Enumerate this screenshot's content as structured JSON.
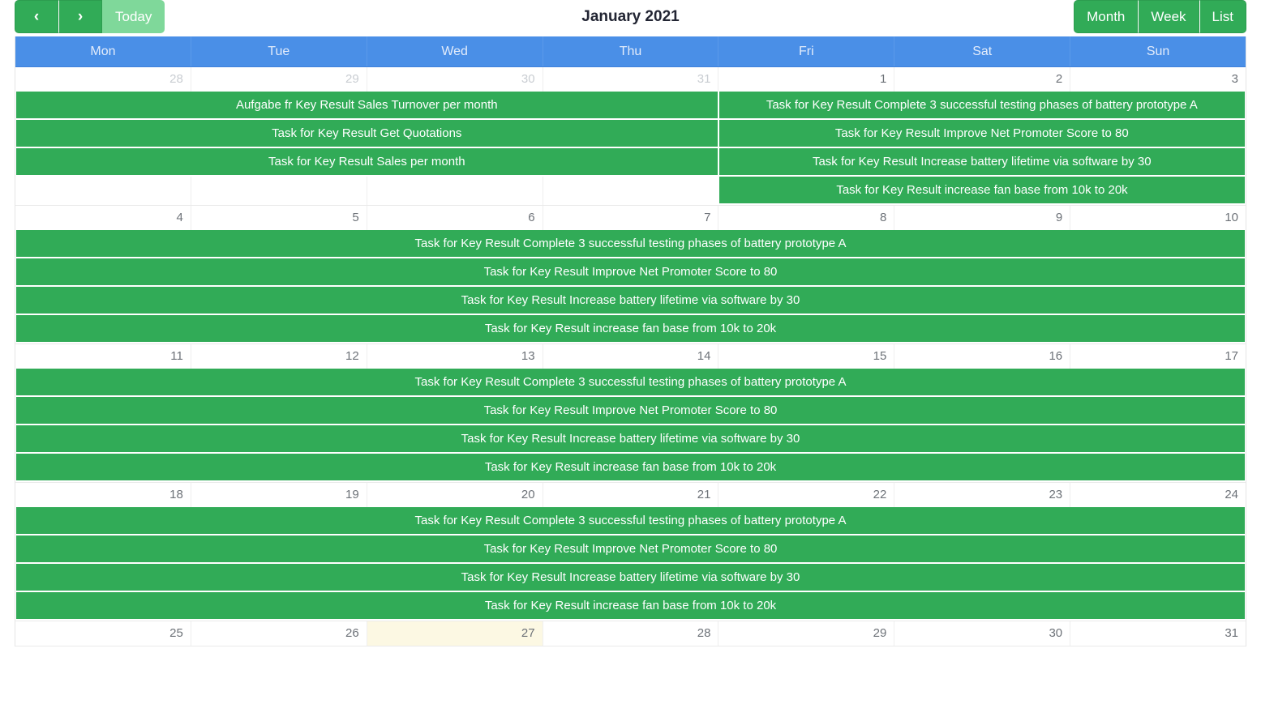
{
  "toolbar": {
    "prev_label": "‹",
    "next_label": "›",
    "today_label": "Today",
    "month_label": "Month",
    "week_label": "Week",
    "list_label": "List"
  },
  "title": "January 2021",
  "colors": {
    "event_green": "#31ab57",
    "header_blue": "#4a8fe7",
    "today_highlight": "#fcf8e3",
    "button_green": "#31ab57",
    "today_button_green": "#7fd89a"
  },
  "day_headers": [
    "Mon",
    "Tue",
    "Wed",
    "Thu",
    "Fri",
    "Sat",
    "Sun"
  ],
  "weeks": [
    {
      "days": [
        {
          "num": "28",
          "other_month": true,
          "today": false
        },
        {
          "num": "29",
          "other_month": true,
          "today": false
        },
        {
          "num": "30",
          "other_month": true,
          "today": false
        },
        {
          "num": "31",
          "other_month": true,
          "today": false
        },
        {
          "num": "1",
          "other_month": false,
          "today": false
        },
        {
          "num": "2",
          "other_month": false,
          "today": false
        },
        {
          "num": "3",
          "other_month": false,
          "today": false
        }
      ],
      "event_lines": [
        [
          {
            "type": "event",
            "span": 4,
            "text": "Aufgabe fr Key Result Sales Turnover per month"
          },
          {
            "type": "event",
            "span": 3,
            "text": "Task for Key Result Complete 3 successful testing phases of battery prototype A"
          }
        ],
        [
          {
            "type": "event",
            "span": 4,
            "text": "Task for Key Result Get Quotations"
          },
          {
            "type": "event",
            "span": 3,
            "text": "Task for Key Result Improve Net Promoter Score to 80"
          }
        ],
        [
          {
            "type": "event",
            "span": 4,
            "text": "Task for Key Result Sales per month"
          },
          {
            "type": "event",
            "span": 3,
            "text": "Task for Key Result Increase battery lifetime via software by 30"
          }
        ],
        [
          {
            "type": "filler",
            "span": 1,
            "text": ""
          },
          {
            "type": "filler",
            "span": 1,
            "text": ""
          },
          {
            "type": "filler",
            "span": 1,
            "text": ""
          },
          {
            "type": "filler",
            "span": 1,
            "text": ""
          },
          {
            "type": "event",
            "span": 3,
            "text": "Task for Key Result increase fan base from 10k to 20k"
          }
        ]
      ]
    },
    {
      "days": [
        {
          "num": "4",
          "other_month": false,
          "today": false
        },
        {
          "num": "5",
          "other_month": false,
          "today": false
        },
        {
          "num": "6",
          "other_month": false,
          "today": false
        },
        {
          "num": "7",
          "other_month": false,
          "today": false
        },
        {
          "num": "8",
          "other_month": false,
          "today": false
        },
        {
          "num": "9",
          "other_month": false,
          "today": false
        },
        {
          "num": "10",
          "other_month": false,
          "today": false
        }
      ],
      "event_lines": [
        [
          {
            "type": "event",
            "span": 7,
            "text": "Task for Key Result Complete 3 successful testing phases of battery prototype A"
          }
        ],
        [
          {
            "type": "event",
            "span": 7,
            "text": "Task for Key Result Improve Net Promoter Score to 80"
          }
        ],
        [
          {
            "type": "event",
            "span": 7,
            "text": "Task for Key Result Increase battery lifetime via software by 30"
          }
        ],
        [
          {
            "type": "event",
            "span": 7,
            "text": "Task for Key Result increase fan base from 10k to 20k"
          }
        ]
      ]
    },
    {
      "days": [
        {
          "num": "11",
          "other_month": false,
          "today": false
        },
        {
          "num": "12",
          "other_month": false,
          "today": false
        },
        {
          "num": "13",
          "other_month": false,
          "today": false
        },
        {
          "num": "14",
          "other_month": false,
          "today": false
        },
        {
          "num": "15",
          "other_month": false,
          "today": false
        },
        {
          "num": "16",
          "other_month": false,
          "today": false
        },
        {
          "num": "17",
          "other_month": false,
          "today": false
        }
      ],
      "event_lines": [
        [
          {
            "type": "event",
            "span": 7,
            "text": "Task for Key Result Complete 3 successful testing phases of battery prototype A"
          }
        ],
        [
          {
            "type": "event",
            "span": 7,
            "text": "Task for Key Result Improve Net Promoter Score to 80"
          }
        ],
        [
          {
            "type": "event",
            "span": 7,
            "text": "Task for Key Result Increase battery lifetime via software by 30"
          }
        ],
        [
          {
            "type": "event",
            "span": 7,
            "text": "Task for Key Result increase fan base from 10k to 20k"
          }
        ]
      ]
    },
    {
      "days": [
        {
          "num": "18",
          "other_month": false,
          "today": false
        },
        {
          "num": "19",
          "other_month": false,
          "today": false
        },
        {
          "num": "20",
          "other_month": false,
          "today": false
        },
        {
          "num": "21",
          "other_month": false,
          "today": false
        },
        {
          "num": "22",
          "other_month": false,
          "today": false
        },
        {
          "num": "23",
          "other_month": false,
          "today": false
        },
        {
          "num": "24",
          "other_month": false,
          "today": false
        }
      ],
      "event_lines": [
        [
          {
            "type": "event",
            "span": 7,
            "text": "Task for Key Result Complete 3 successful testing phases of battery prototype A"
          }
        ],
        [
          {
            "type": "event",
            "span": 7,
            "text": "Task for Key Result Improve Net Promoter Score to 80"
          }
        ],
        [
          {
            "type": "event",
            "span": 7,
            "text": "Task for Key Result Increase battery lifetime via software by 30"
          }
        ],
        [
          {
            "type": "event",
            "span": 7,
            "text": "Task for Key Result increase fan base from 10k to 20k"
          }
        ]
      ]
    },
    {
      "days": [
        {
          "num": "25",
          "other_month": false,
          "today": false
        },
        {
          "num": "26",
          "other_month": false,
          "today": false
        },
        {
          "num": "27",
          "other_month": false,
          "today": true
        },
        {
          "num": "28",
          "other_month": false,
          "today": false
        },
        {
          "num": "29",
          "other_month": false,
          "today": false
        },
        {
          "num": "30",
          "other_month": false,
          "today": false
        },
        {
          "num": "31",
          "other_month": false,
          "today": false
        }
      ],
      "event_lines": []
    }
  ]
}
